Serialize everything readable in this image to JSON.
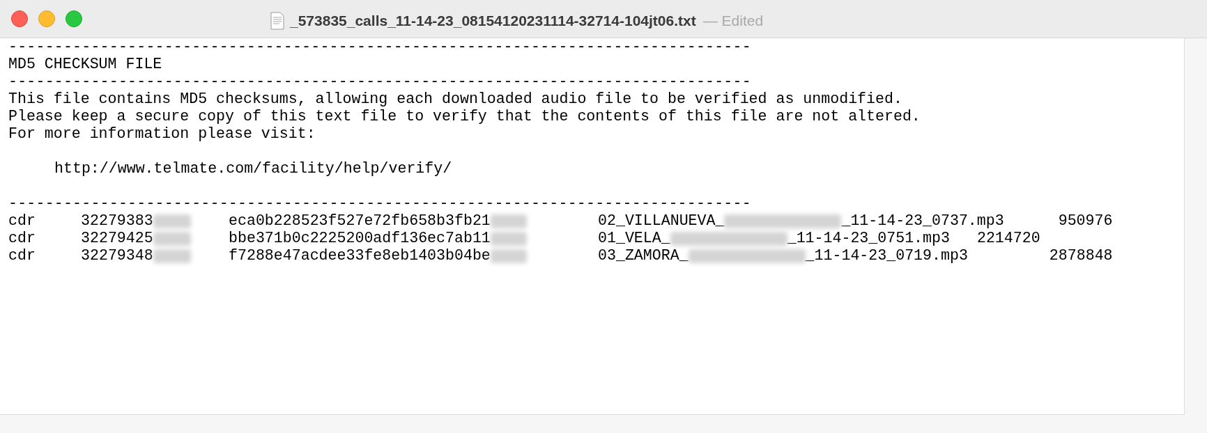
{
  "window": {
    "title": "_573835_calls_11-14-23_08154120231114-32714-104jt06.txt",
    "status": "— Edited"
  },
  "lines": [
    {
      "kind": "rule",
      "text": "---------------------------------------------------------------------------------"
    },
    {
      "kind": "text",
      "text": "MD5 CHECKSUM FILE"
    },
    {
      "kind": "rule",
      "text": "---------------------------------------------------------------------------------"
    },
    {
      "kind": "text",
      "text": "This file contains MD5 checksums, allowing each downloaded audio file to be verified as unmodified."
    },
    {
      "kind": "text",
      "text": "Please keep a secure copy of this text file to verify that the contents of this file are not altered."
    },
    {
      "kind": "text",
      "text": "For more information please visit:"
    },
    {
      "kind": "blank"
    },
    {
      "kind": "link",
      "text": "http://www.telmate.com/facility/help/verify/"
    },
    {
      "kind": "blank"
    },
    {
      "kind": "rule",
      "text": "---------------------------------------------------------------------------------"
    }
  ],
  "rows": [
    {
      "type": "cdr",
      "id": "32279383",
      "hash": "eca0b228523f527e72fb658b3fb21",
      "file_prefix": "02_VILLANUEVA_",
      "file_suffix": "_11-14-23_0737.mp3",
      "size": "950976"
    },
    {
      "type": "cdr",
      "id": "32279425",
      "hash": "bbe371b0c2225200adf136ec7ab11",
      "file_prefix": "01_VELA_",
      "file_suffix": "_11-14-23_0751.mp3",
      "size": "2214720"
    },
    {
      "type": "cdr",
      "id": "32279348",
      "hash": "f7288e47acdee33fe8eb1403b04be",
      "file_prefix": "03_ZAMORA_",
      "file_suffix": "_11-14-23_0719.mp3",
      "size": "2878848"
    }
  ]
}
